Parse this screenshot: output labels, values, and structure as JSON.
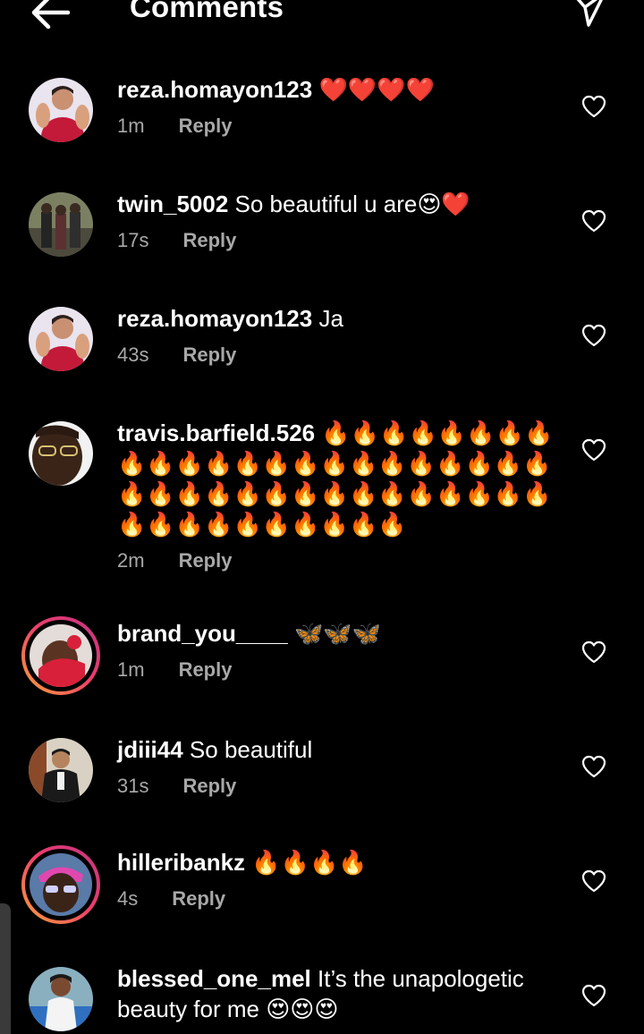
{
  "header": {
    "title": "Comments",
    "back_icon": "arrow-left-icon",
    "send_icon": "paper-plane-icon"
  },
  "comments": [
    {
      "username": "reza.homayon123",
      "text": " ❤️❤️❤️❤️",
      "time": "1m",
      "reply": "Reply"
    },
    {
      "username": "twin_5002",
      "text": " So beautiful u are😍❤️",
      "time": "17s",
      "reply": "Reply"
    },
    {
      "username": "reza.homayon123",
      "text": " Ja",
      "time": "43s",
      "reply": "Reply"
    },
    {
      "username": "travis.barfield.526",
      "text": " 🔥🔥🔥🔥🔥🔥🔥🔥🔥🔥🔥🔥🔥🔥🔥🔥🔥🔥🔥🔥🔥🔥🔥🔥🔥🔥🔥🔥🔥🔥🔥🔥🔥🔥🔥🔥🔥🔥🔥🔥🔥🔥🔥🔥🔥🔥🔥🔥",
      "time": "2m",
      "reply": "Reply"
    },
    {
      "username": "brand_you____",
      "text": " 🦋🦋🦋",
      "time": "1m",
      "reply": "Reply"
    },
    {
      "username": "jdiii44",
      "text": " So beautiful",
      "time": "31s",
      "reply": "Reply"
    },
    {
      "username": "hilleribankz",
      "text": " 🔥🔥🔥🔥",
      "time": "4s",
      "reply": "Reply"
    },
    {
      "username": "blessed_one_mel",
      "text": " It’s the unapologetic beauty for me 😍😍😍",
      "time": "",
      "reply": ""
    }
  ],
  "colors": {
    "background": "#000000",
    "text": "#ffffff",
    "meta": "#a8a8a8",
    "story_ring_start": "#f9a33a",
    "story_ring_end": "#c13584"
  }
}
